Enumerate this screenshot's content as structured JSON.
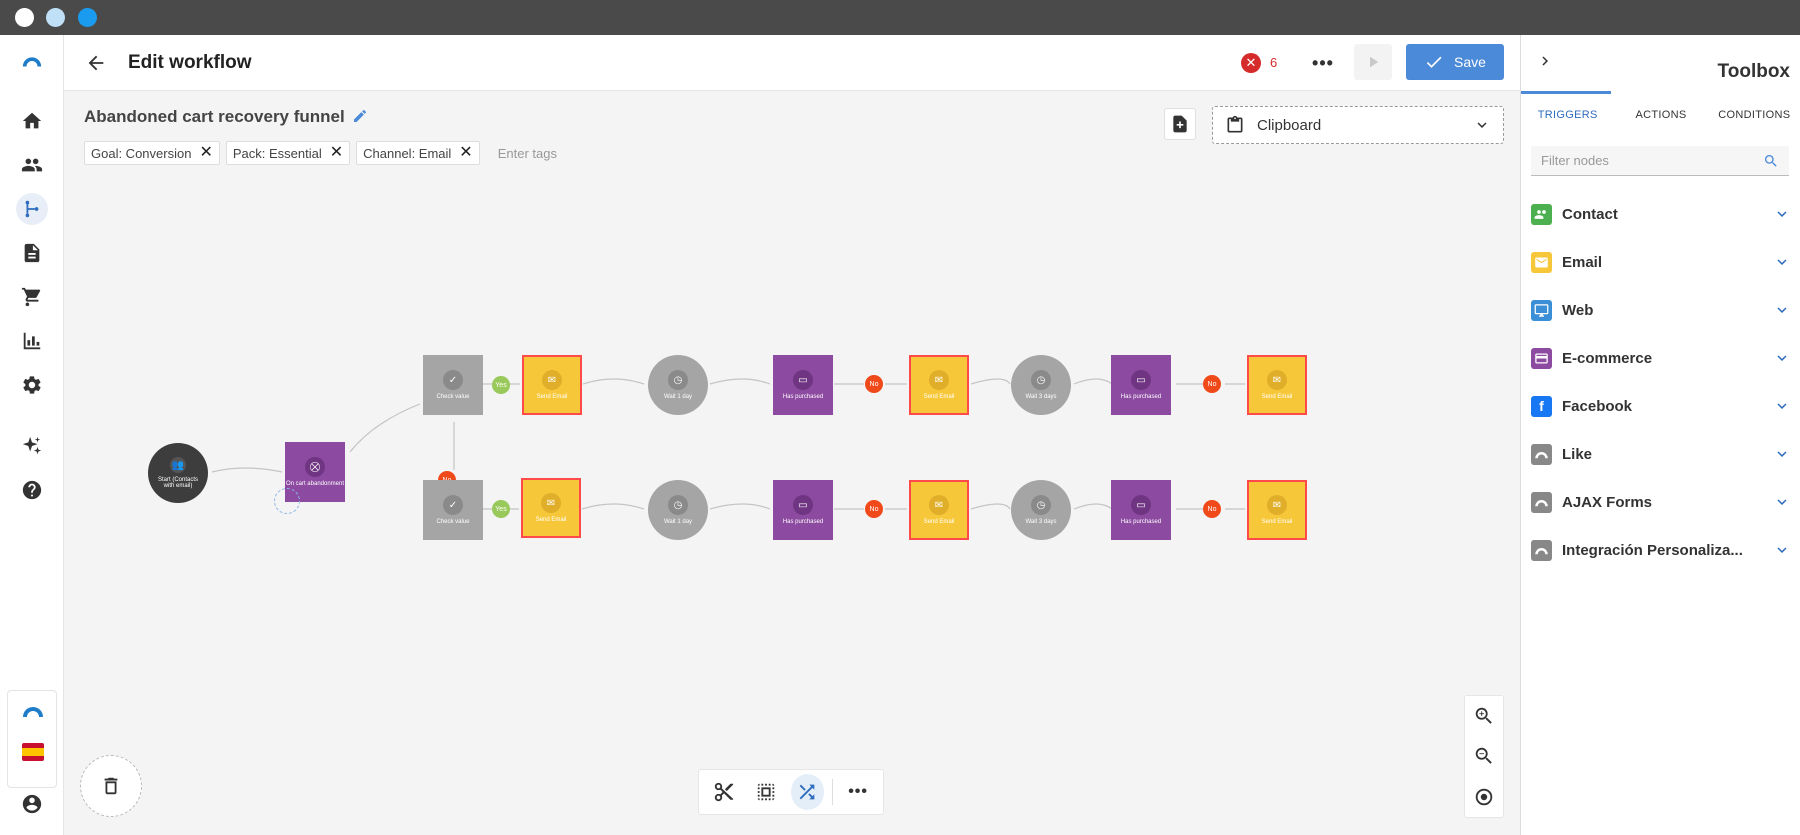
{
  "header": {
    "title": "Edit workflow",
    "error_count": "6",
    "save_label": "Save"
  },
  "workflow": {
    "name": "Abandoned cart recovery funnel",
    "tags": [
      "Goal: Conversion",
      "Pack: Essential",
      "Channel: Email"
    ],
    "tag_placeholder": "Enter tags"
  },
  "clipboard": {
    "label": "Clipboard"
  },
  "nodes": {
    "start": "Start (Contacts with email)",
    "trigger": "On cart abandonment",
    "check": "Check value",
    "send": "Send Email",
    "wait1": "Wait 1 day",
    "wait3": "Wait 3 days",
    "purchased": "Has purchased",
    "yes": "Yes",
    "no": "No"
  },
  "toolbox": {
    "title": "Toolbox",
    "tabs": [
      "TRIGGERS",
      "ACTIONS",
      "CONDITIONS"
    ],
    "active_tab": "TRIGGERS",
    "filter_placeholder": "Filter nodes",
    "categories": [
      {
        "label": "Contact",
        "icon": "contacts-icon",
        "color": "#4caf50"
      },
      {
        "label": "Email",
        "icon": "email-icon",
        "color": "#f7c73a"
      },
      {
        "label": "Web",
        "icon": "monitor-icon",
        "color": "#3a8fd6"
      },
      {
        "label": "E-commerce",
        "icon": "card-icon",
        "color": "#8c4aa0"
      },
      {
        "label": "Facebook",
        "icon": "facebook-icon",
        "color": "#1877f2"
      },
      {
        "label": "Like",
        "icon": "connectif-icon",
        "color": "#888888"
      },
      {
        "label": "AJAX Forms",
        "icon": "connectif-icon",
        "color": "#888888"
      },
      {
        "label": "Integración Personaliza...",
        "icon": "connectif-icon",
        "color": "#888888"
      }
    ]
  },
  "colors": {
    "accent": "#4a8ad8",
    "error": "#d62b2b",
    "node_purple": "#8c4aa0",
    "node_yellow": "#f7c73a",
    "node_grey": "#a5a5a5"
  }
}
